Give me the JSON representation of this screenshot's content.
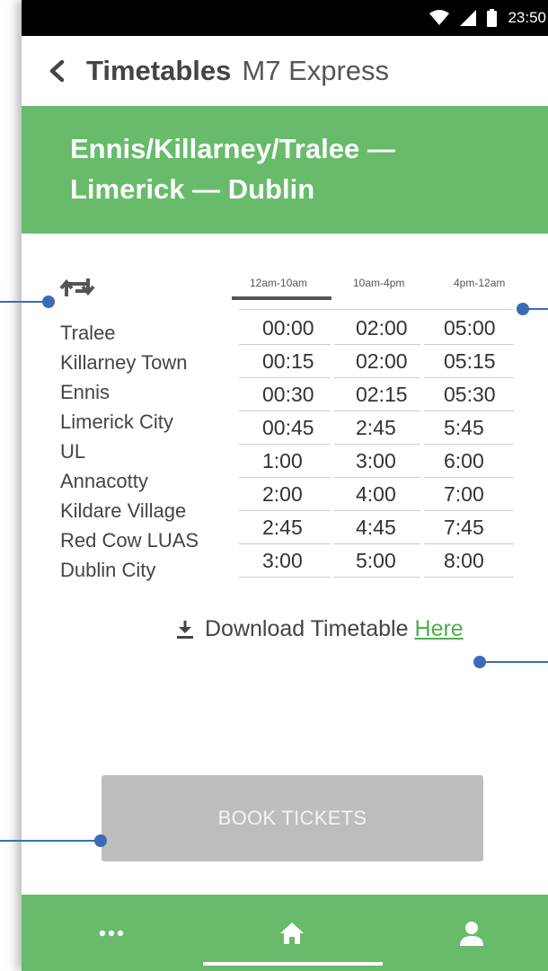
{
  "status_bar": {
    "time": "23:50"
  },
  "header": {
    "title": "Timetables",
    "subtitle": "M7 Express"
  },
  "banner": {
    "line1": "Ennis/Killarney/Tralee —",
    "line2": "Limerick — Dublin"
  },
  "tabs": [
    {
      "label": "12am-10am",
      "active": true
    },
    {
      "label": "10am-4pm",
      "active": false
    },
    {
      "label": "4pm-12am",
      "active": false
    }
  ],
  "stations": [
    "Tralee",
    "Killarney Town",
    "Ennis",
    "Limerick City",
    "UL",
    "Annacotty",
    "Kildare Village",
    "Red Cow LUAS",
    "Dublin City"
  ],
  "times": {
    "col1": [
      "00:00",
      "00:15",
      "00:30",
      "00:45",
      "1:00",
      "2:00",
      "2:45",
      "3:00"
    ],
    "col2": [
      "02:00",
      "02:00",
      "02:15",
      "2:45",
      "3:00",
      "4:00",
      "4:45",
      "5:00"
    ],
    "col3": [
      "05:00",
      "05:15",
      "05:30",
      "5:45",
      "6:00",
      "7:00",
      "7:45",
      "8:00"
    ]
  },
  "download": {
    "text": "Download Timetable",
    "link": "Here"
  },
  "book_button": {
    "label": "BOOK TICKETS"
  },
  "colors": {
    "green": "#67bb6a",
    "button_grey": "#bdbdbd",
    "annotation_blue": "#3a6bb8"
  },
  "icons": {
    "back": "chevron-left-icon",
    "swap": "swap-direction-icon",
    "download": "download-icon",
    "menu": "more-dots-icon",
    "home": "home-icon",
    "profile": "person-icon"
  }
}
